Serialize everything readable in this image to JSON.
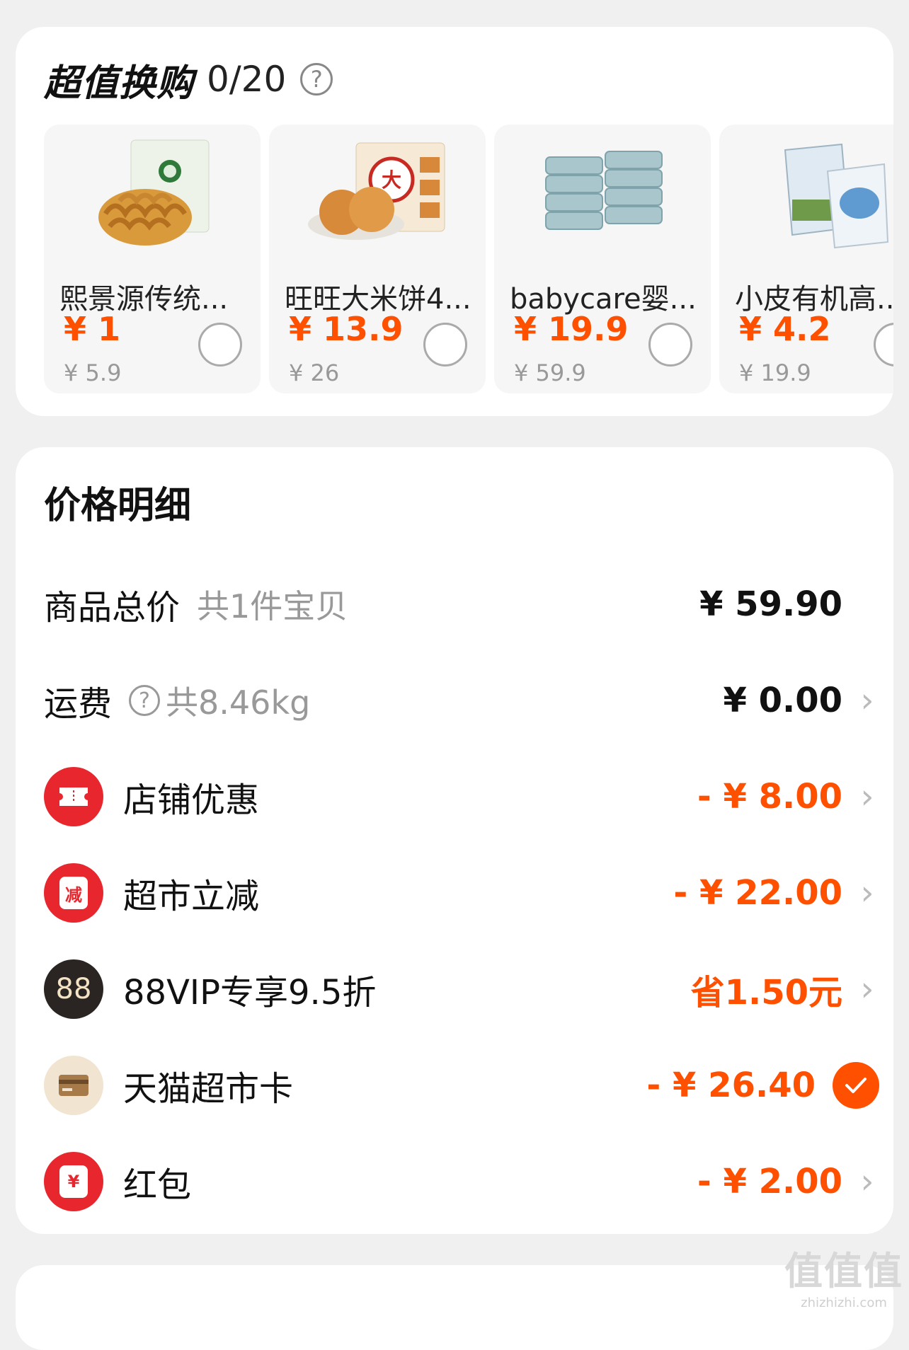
{
  "exchange": {
    "title": "超值换购",
    "count": "0/20",
    "help_icon": "?",
    "products": [
      {
        "name": "熙景源传统...",
        "price": "¥ 1",
        "orig": "¥ 5.9",
        "image": "twisted-snack-image"
      },
      {
        "name": "旺旺大米饼4...",
        "price": "¥ 13.9",
        "orig": "¥ 26",
        "image": "rice-cracker-image"
      },
      {
        "name": "babycare婴...",
        "price": "¥ 19.9",
        "orig": "¥ 59.9",
        "image": "baby-wipes-image"
      },
      {
        "name": "小皮有机高...",
        "price": "¥ 4.2",
        "orig": "¥ 19.9",
        "image": "organic-cereal-image"
      }
    ]
  },
  "price": {
    "title": "价格明细",
    "rows": [
      {
        "label": "商品总价",
        "sub": "共1件宝贝",
        "value": "¥ 59.90"
      },
      {
        "label": "运费",
        "help": "?",
        "sub": "共8.46kg",
        "value": "¥ 0.00"
      },
      {
        "label": "店铺优惠",
        "value": "- ¥ 8.00",
        "icon": "ticket-icon"
      },
      {
        "label": "超市立减",
        "value": "- ¥ 22.00",
        "icon": "discount-jar-icon",
        "icon_text": "减"
      },
      {
        "label": "88VIP专享9.5折",
        "value": "省1.50元",
        "icon": "vip88-icon",
        "icon_text": "88"
      },
      {
        "label": "天猫超市卡",
        "value": "- ¥ 26.40",
        "icon": "card-icon",
        "checked": true
      },
      {
        "label": "红包",
        "value": "- ¥ 2.00",
        "icon": "red-packet-icon",
        "icon_text": "¥"
      }
    ]
  },
  "watermark": {
    "main": "值值值",
    "sub": "zhizhizhi.com"
  },
  "colors": {
    "accent": "#ff5000",
    "icon_red": "#e8262e",
    "icon_black": "#2a2522",
    "icon_tan": "#f1e4d1"
  }
}
